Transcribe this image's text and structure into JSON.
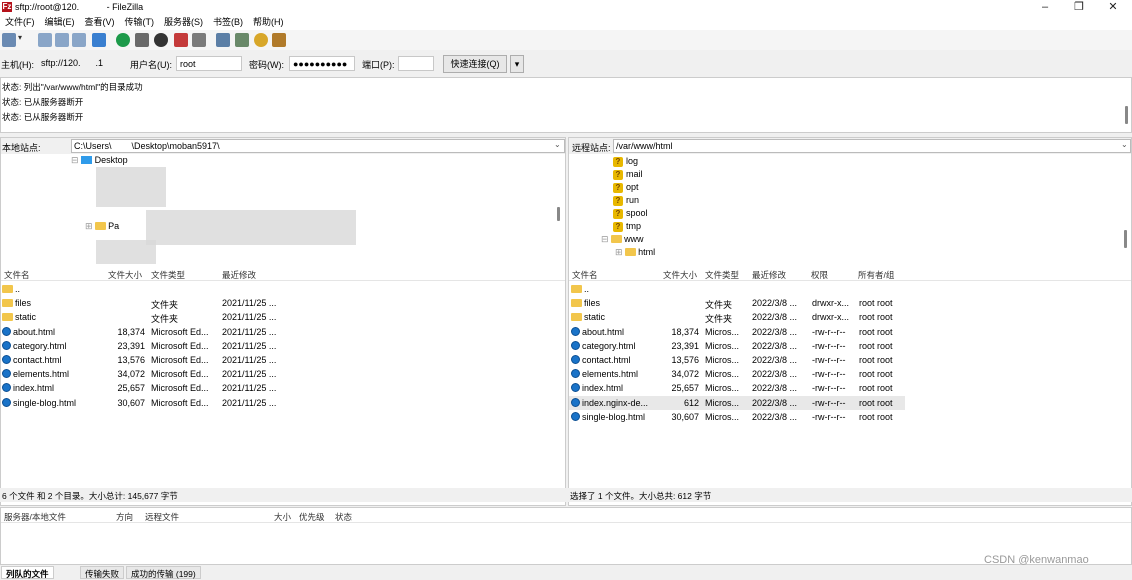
{
  "window": {
    "title": "sftp://root@120.           - FileZilla",
    "app_icon": "Fz",
    "minimize": "–",
    "maximize": "❐",
    "close": "✕"
  },
  "menu": [
    "文件(F)",
    "编辑(E)",
    "查看(V)",
    "传输(T)",
    "服务器(S)",
    "书签(B)",
    "帮助(H)"
  ],
  "quickconnect": {
    "host_label": "主机(H):",
    "host_value": "sftp://120.      .1",
    "user_label": "用户名(U):",
    "user_value": "root",
    "pass_label": "密码(W):",
    "pass_value": "●●●●●●●●●●",
    "port_label": "端口(P):",
    "port_value": "",
    "connect_button": "快速连接(Q)",
    "dropdown": "▾"
  },
  "log": [
    "状态: 列出\"/var/www/html\"的目录成功",
    "状态: 已从服务器断开",
    "状态: 已从服务器断开"
  ],
  "local": {
    "site_label": "本地站点:",
    "site_path": "C:\\Users\\        \\Desktop\\moban5917\\",
    "tree": {
      "desktop": "Desktop",
      "partial": "Pa"
    },
    "headers": [
      "文件名",
      "文件大小",
      "文件类型",
      "最近修改"
    ],
    "files": [
      {
        "name": "..",
        "size": "",
        "type": "",
        "modified": "",
        "icon": "folder"
      },
      {
        "name": "files",
        "size": "",
        "type": "文件夹",
        "modified": "2021/11/25 ...",
        "icon": "folder"
      },
      {
        "name": "static",
        "size": "",
        "type": "文件夹",
        "modified": "2021/11/25 ...",
        "icon": "folder"
      },
      {
        "name": "about.html",
        "size": "18,374",
        "type": "Microsoft Ed...",
        "modified": "2021/11/25 ...",
        "icon": "edge"
      },
      {
        "name": "category.html",
        "size": "23,391",
        "type": "Microsoft Ed...",
        "modified": "2021/11/25 ...",
        "icon": "edge"
      },
      {
        "name": "contact.html",
        "size": "13,576",
        "type": "Microsoft Ed...",
        "modified": "2021/11/25 ...",
        "icon": "edge"
      },
      {
        "name": "elements.html",
        "size": "34,072",
        "type": "Microsoft Ed...",
        "modified": "2021/11/25 ...",
        "icon": "edge"
      },
      {
        "name": "index.html",
        "size": "25,657",
        "type": "Microsoft Ed...",
        "modified": "2021/11/25 ...",
        "icon": "edge"
      },
      {
        "name": "single-blog.html",
        "size": "30,607",
        "type": "Microsoft Ed...",
        "modified": "2021/11/25 ...",
        "icon": "edge"
      }
    ],
    "status": "6 个文件 和 2 个目录。大小总计: 145,677 字节"
  },
  "remote": {
    "site_label": "远程站点:",
    "site_path": "/var/www/html",
    "tree": [
      "log",
      "mail",
      "opt",
      "run",
      "spool",
      "tmp"
    ],
    "tree_www": "www",
    "tree_html": "html",
    "headers": [
      "文件名",
      "文件大小",
      "文件类型",
      "最近修改",
      "权限",
      "所有者/组"
    ],
    "files": [
      {
        "name": "..",
        "size": "",
        "type": "",
        "modified": "",
        "perm": "",
        "owner": "",
        "icon": "folder"
      },
      {
        "name": "files",
        "size": "",
        "type": "文件夹",
        "modified": "2022/3/8 ...",
        "perm": "drwxr-x...",
        "owner": "root root",
        "icon": "folder"
      },
      {
        "name": "static",
        "size": "",
        "type": "文件夹",
        "modified": "2022/3/8 ...",
        "perm": "drwxr-x...",
        "owner": "root root",
        "icon": "folder"
      },
      {
        "name": "about.html",
        "size": "18,374",
        "type": "Micros...",
        "modified": "2022/3/8 ...",
        "perm": "-rw-r--r--",
        "owner": "root root",
        "icon": "edge"
      },
      {
        "name": "category.html",
        "size": "23,391",
        "type": "Micros...",
        "modified": "2022/3/8 ...",
        "perm": "-rw-r--r--",
        "owner": "root root",
        "icon": "edge"
      },
      {
        "name": "contact.html",
        "size": "13,576",
        "type": "Micros...",
        "modified": "2022/3/8 ...",
        "perm": "-rw-r--r--",
        "owner": "root root",
        "icon": "edge"
      },
      {
        "name": "elements.html",
        "size": "34,072",
        "type": "Micros...",
        "modified": "2022/3/8 ...",
        "perm": "-rw-r--r--",
        "owner": "root root",
        "icon": "edge"
      },
      {
        "name": "index.html",
        "size": "25,657",
        "type": "Micros...",
        "modified": "2022/3/8 ...",
        "perm": "-rw-r--r--",
        "owner": "root root",
        "icon": "edge"
      },
      {
        "name": "index.nginx-de...",
        "size": "612",
        "type": "Micros...",
        "modified": "2022/3/8 ...",
        "perm": "-rw-r--r--",
        "owner": "root root",
        "icon": "edge",
        "selected": true
      },
      {
        "name": "single-blog.html",
        "size": "30,607",
        "type": "Micros...",
        "modified": "2022/3/8 ...",
        "perm": "-rw-r--r--",
        "owner": "root root",
        "icon": "edge"
      }
    ],
    "status": "选择了 1 个文件。大小总共: 612 字节"
  },
  "queue": {
    "headers": [
      "服务器/本地文件",
      "方向",
      "远程文件",
      "大小",
      "优先级",
      "状态"
    ]
  },
  "tabs": [
    "列队的文件",
    "传输失败",
    "成功的传输 (199)"
  ],
  "watermark": "CSDN @kenwanmao"
}
